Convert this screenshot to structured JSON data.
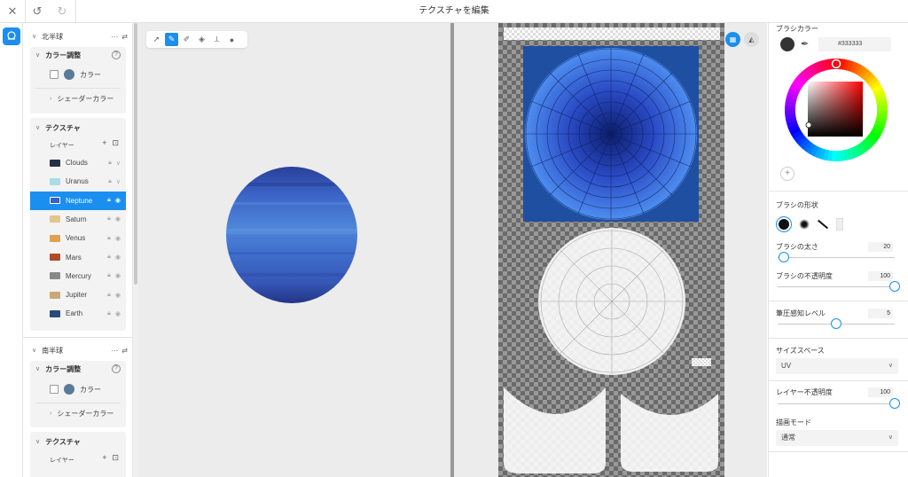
{
  "window": {
    "title": "テクスチャを編集"
  },
  "toolbar_top": {
    "close_icon": "close-icon",
    "undo_icon": "undo-icon",
    "redo_icon": "redo-icon"
  },
  "layers_panel": {
    "north": {
      "title": "北半球",
      "color_adjust": {
        "title": "カラー調整",
        "color_label": "カラー",
        "color": "#5c7a96",
        "shader_color": "シェーダーカラー"
      },
      "texture": {
        "title": "テクスチャ",
        "layer_label": "レイヤー",
        "layers": [
          {
            "name": "Clouds",
            "color": "#223045",
            "selected": false
          },
          {
            "name": "Uranus",
            "color": "#a8dde6",
            "selected": false
          },
          {
            "name": "Neptune",
            "color": "#3a5fc0",
            "selected": true
          },
          {
            "name": "Saturn",
            "color": "#e3c58e",
            "selected": false
          },
          {
            "name": "Venus",
            "color": "#e0a050",
            "selected": false
          },
          {
            "name": "Mars",
            "color": "#b04a2a",
            "selected": false
          },
          {
            "name": "Mercury",
            "color": "#888888",
            "selected": false
          },
          {
            "name": "Jupiter",
            "color": "#c9a877",
            "selected": false
          },
          {
            "name": "Earth",
            "color": "#2a4a7a",
            "selected": false
          }
        ]
      }
    },
    "south": {
      "title": "南半球",
      "color_adjust": {
        "title": "カラー調整",
        "color_label": "カラー",
        "shader_color": "シェーダーカラー"
      },
      "texture": {
        "title": "テクスチャ",
        "layer_label": "レイヤー"
      }
    }
  },
  "props": {
    "brush_color": {
      "title": "ブラシカラー",
      "hex": "#333333"
    },
    "brush_shape": {
      "title": "ブラシの形状"
    },
    "brush_size": {
      "label": "ブラシの太さ",
      "value": "20",
      "fraction": 0.05
    },
    "brush_opacity": {
      "label": "ブラシの不透明度",
      "value": "100",
      "fraction": 1.0
    },
    "pressure": {
      "label": "筆圧感知レベル",
      "value": "5",
      "fraction": 0.5
    },
    "size_space": {
      "label": "サイズスペース",
      "value": "UV"
    },
    "layer_opacity": {
      "label": "レイヤー不透明度",
      "value": "100",
      "fraction": 1.0
    },
    "blend_mode": {
      "label": "描画モード",
      "value": "通常"
    }
  }
}
